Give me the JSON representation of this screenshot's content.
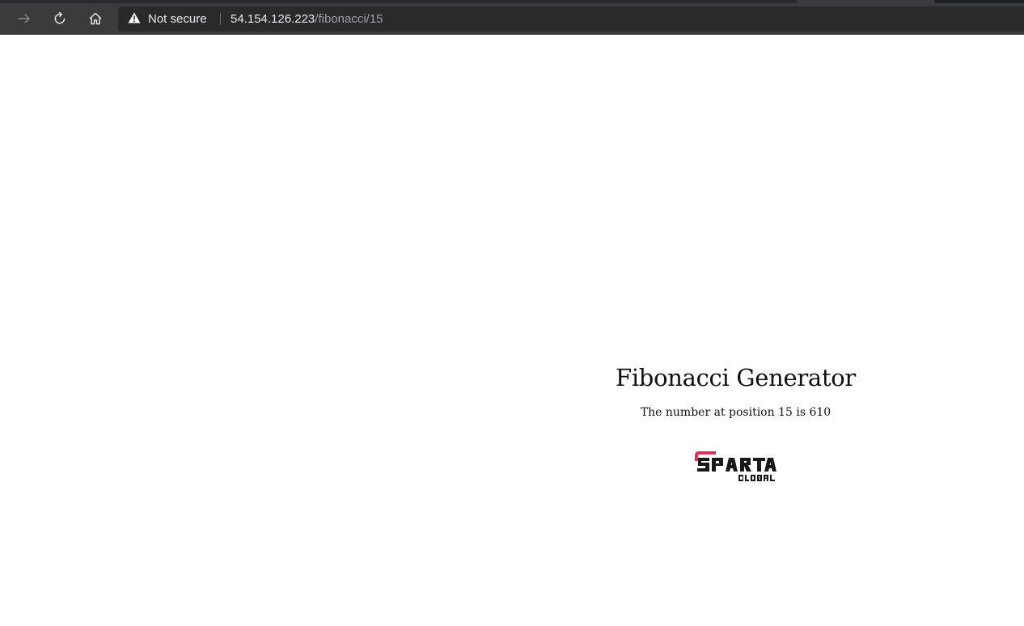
{
  "browser": {
    "security_label": "Not secure",
    "url_host": "54.154.126.223",
    "url_path": "/fibonacci/15",
    "icons": {
      "forward": "arrow-right-icon",
      "reload": "reload-icon",
      "home": "home-icon",
      "warning": "warning-triangle-icon"
    }
  },
  "page": {
    "title": "Fibonacci Generator",
    "result": "The number at position 15 is 610",
    "logo": {
      "wordmark": "SPARTA",
      "subtext": "GLOBAL",
      "accent_color": "#e0305a",
      "text_color": "#1a1a1a"
    }
  }
}
